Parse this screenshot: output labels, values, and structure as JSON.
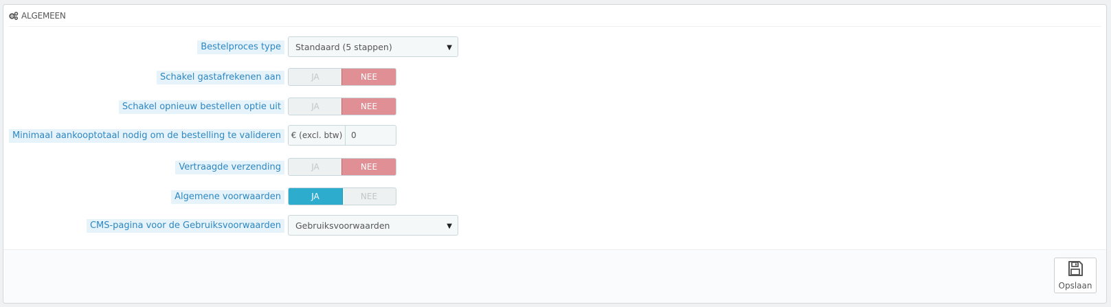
{
  "panel": {
    "title": "ALGEMEEN",
    "icon": "cogs-icon"
  },
  "fields": {
    "checkout_type": {
      "label": "Bestelproces type",
      "value": "Standaard (5 stappen)"
    },
    "guest_checkout": {
      "label": "Schakel gastafrekenen aan",
      "yes": "JA",
      "no": "NEE",
      "selected": "NEE"
    },
    "reorder_option": {
      "label": "Schakel opnieuw bestellen optie uit",
      "yes": "JA",
      "no": "NEE",
      "selected": "NEE"
    },
    "min_purchase": {
      "label": "Minimaal aankooptotaal nodig om de bestelling te valideren",
      "addon": "€ (excl. btw)",
      "value": "0"
    },
    "delayed_shipping": {
      "label": "Vertraagde verzending",
      "yes": "JA",
      "no": "NEE",
      "selected": "NEE"
    },
    "terms": {
      "label": "Algemene voorwaarden",
      "yes": "JA",
      "no": "NEE",
      "selected": "JA"
    },
    "cms_page": {
      "label": "CMS-pagina voor de Gebruiksvoorwaarden",
      "value": "Gebruiksvoorwaarden"
    }
  },
  "footer": {
    "save_label": "Opslaan",
    "save_icon": "save-icon"
  },
  "colors": {
    "label_bg": "#e7f3fb",
    "label_text": "#2c87c2",
    "no_active": "#e08f95",
    "yes_active": "#2eacce"
  }
}
